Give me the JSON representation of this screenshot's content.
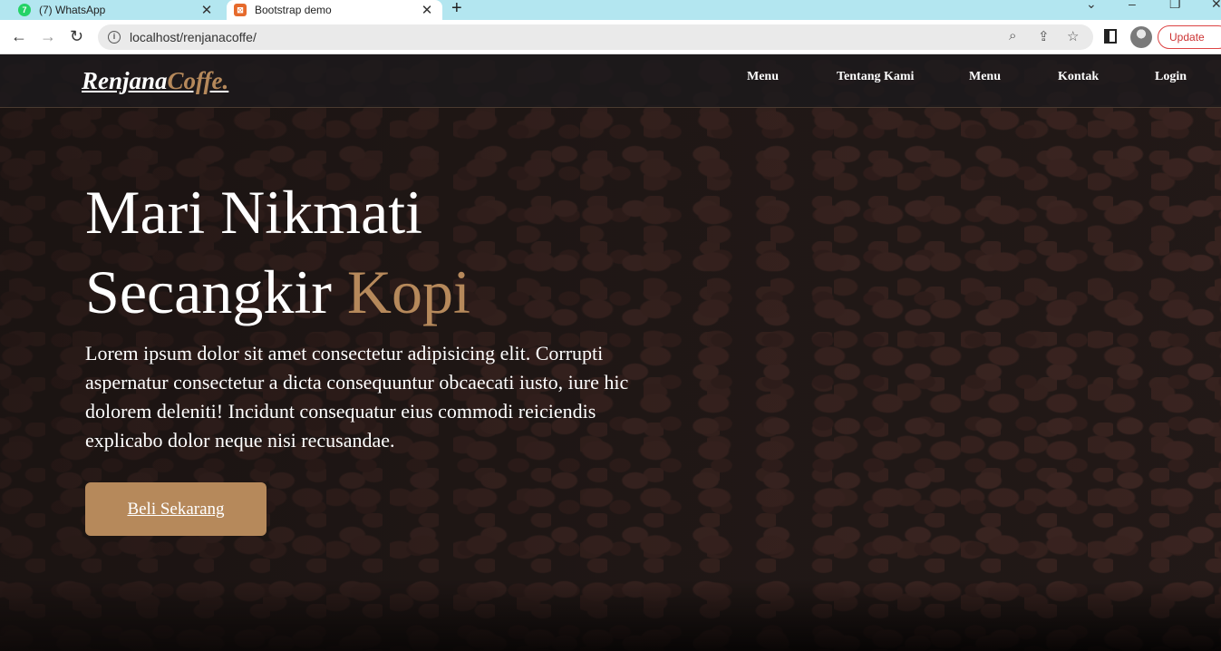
{
  "browser": {
    "tabs": [
      {
        "title": "(7) WhatsApp",
        "favicon": "whatsapp-icon",
        "badge": "7"
      },
      {
        "title": "Bootstrap demo",
        "favicon": "xampp-icon"
      }
    ],
    "url": "localhost/renjanacoffe/",
    "update_label": "Update"
  },
  "site": {
    "logo": {
      "brand": "Renjana",
      "accent": "Coffe."
    },
    "nav": [
      "Menu",
      "Tentang Kami",
      "Menu",
      "Kontak",
      "Login"
    ],
    "hero": {
      "headline_line1": "Mari Nikmati",
      "headline_line2": "Secangkir",
      "headline_accent": "Kopi",
      "lead": "Lorem ipsum dolor sit amet consectetur adipisicing elit. Corrupti aspernatur consectetur a dicta consequuntur obcaecati iusto, iure hic dolorem deleniti! Incidunt consequatur eius commodi reiciendis explicabo dolor neque nisi recusandae.",
      "cta_label": "Beli Sekarang"
    },
    "colors": {
      "accent": "#b6895b",
      "navbar": "#1c1a1c",
      "background": "#231a18"
    }
  }
}
